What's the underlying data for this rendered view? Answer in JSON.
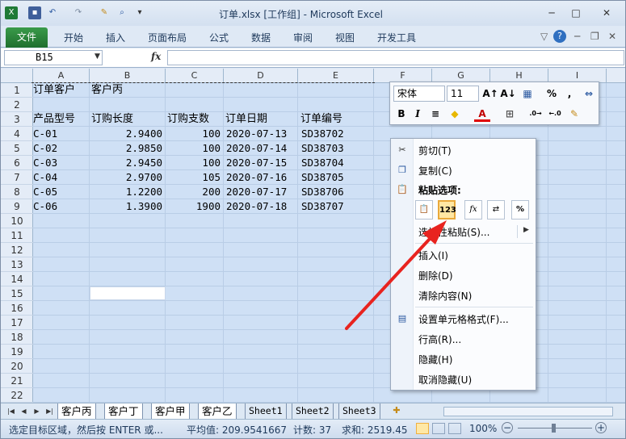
{
  "window": {
    "title": "订单.xlsx  [工作组] - Microsoft Excel"
  },
  "quick_access": {
    "icons": [
      "excel-icon",
      "save-icon",
      "undo-icon",
      "redo-icon",
      "brush-icon",
      "preview-icon",
      "customize-icon"
    ]
  },
  "ribbon": {
    "file_label": "文件",
    "tabs": [
      "开始",
      "插入",
      "页面布局",
      "公式",
      "数据",
      "审阅",
      "视图",
      "开发工具"
    ]
  },
  "formula_bar": {
    "name_box": "B15",
    "fx_label": "fx",
    "value": ""
  },
  "columns": [
    "A",
    "B",
    "C",
    "D",
    "E",
    "F",
    "G",
    "H",
    "I"
  ],
  "rows": [
    "1",
    "2",
    "3",
    "4",
    "5",
    "6",
    "7",
    "8",
    "9",
    "10",
    "11",
    "12",
    "13",
    "14",
    "15",
    "16",
    "17",
    "18",
    "19",
    "20",
    "21",
    "22"
  ],
  "sheet": {
    "r1": [
      "订单客户",
      "客户丙"
    ],
    "headers": [
      "产品型号",
      "订购长度",
      "订购支数",
      "订单日期",
      "订单编号"
    ],
    "data": [
      [
        "C-01",
        "2.9400",
        "100",
        "2020-07-13",
        "SD38702"
      ],
      [
        "C-02",
        "2.9850",
        "100",
        "2020-07-14",
        "SD38703"
      ],
      [
        "C-03",
        "2.9450",
        "100",
        "2020-07-15",
        "SD38704"
      ],
      [
        "C-04",
        "2.9700",
        "105",
        "2020-07-16",
        "SD38705"
      ],
      [
        "C-05",
        "1.2200",
        "200",
        "2020-07-17",
        "SD38706"
      ],
      [
        "C-06",
        "1.3900",
        "1900",
        "2020-07-18",
        "SD38707"
      ]
    ]
  },
  "sheet_tabs": [
    "客户丙",
    "客户丁",
    "客户甲",
    "客户乙",
    "Sheet1",
    "Sheet2",
    "Sheet3"
  ],
  "status": {
    "message": "选定目标区域，然后按 ENTER 或...",
    "average": "平均值: 209.9541667",
    "count": "计数: 37",
    "sum": "求和: 2519.45",
    "zoom": "100%"
  },
  "mini_toolbar": {
    "font": "宋体",
    "size": "11",
    "row1": [
      "A↑",
      "A↓",
      "%",
      ","
    ],
    "row2": [
      "B",
      "I",
      "≡",
      "A"
    ]
  },
  "context_menu": {
    "cut": "剪切(T)",
    "copy": "复制(C)",
    "paste_options": "粘贴选项:",
    "paste_buttons": [
      "📋",
      "123",
      "fx",
      "⇄",
      "%"
    ],
    "paste_special": "选择性粘贴(S)...",
    "insert": "插入(I)",
    "delete": "删除(D)",
    "clear": "清除内容(N)",
    "format": "设置单元格格式(F)...",
    "row_height": "行高(R)...",
    "hide": "隐藏(H)",
    "unhide": "取消隐藏(U)"
  },
  "colors": {
    "accent": "#1f6f2e",
    "arrow": "#e8231f",
    "grid_fill": "#cfe0f5"
  }
}
